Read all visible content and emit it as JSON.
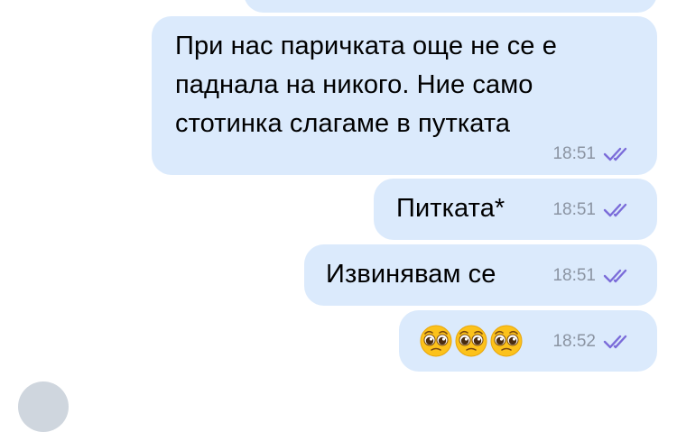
{
  "messages": [
    {
      "text": "",
      "time": ""
    },
    {
      "text": "При нас паричката още не се е паднала на никого. Ние само стотинка слагаме в путката",
      "time": "18:51",
      "status": "read"
    },
    {
      "text": "Питката*",
      "time": "18:51",
      "status": "read"
    },
    {
      "text": "Извинявам се",
      "time": "18:51",
      "status": "read"
    },
    {
      "text": "",
      "emoji": [
        "pleading-face",
        "pleading-face",
        "pleading-face"
      ],
      "time": "18:52",
      "status": "read"
    }
  ],
  "colors": {
    "bubble": "#dbeafc",
    "time": "#8b94a2",
    "checks": "#7b6cd9"
  }
}
